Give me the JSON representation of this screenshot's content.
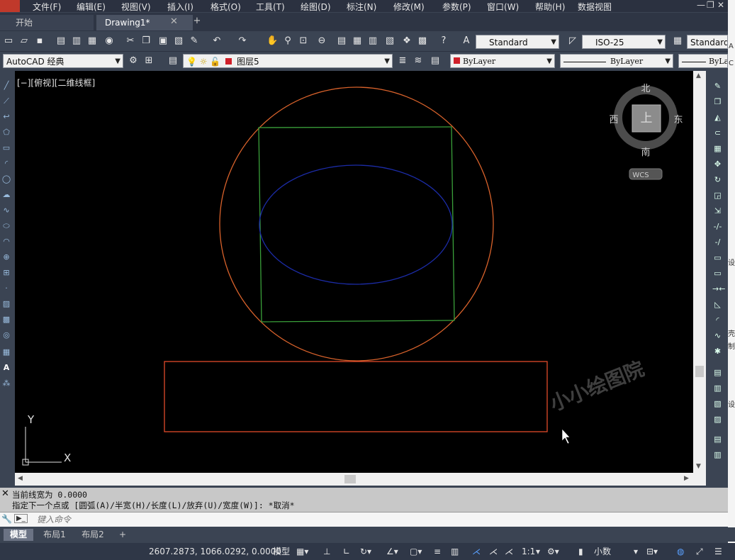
{
  "menu": [
    "文件(F)",
    "编辑(E)",
    "视图(V)",
    "插入(I)",
    "格式(O)",
    "工具(T)",
    "绘图(D)",
    "标注(N)",
    "修改(M)",
    "参数(P)",
    "窗口(W)",
    "帮助(H)",
    "数据视图"
  ],
  "window_controls": {
    "minimize": "—",
    "restore": "❐",
    "close": "✕"
  },
  "tabs": {
    "start": "开始",
    "drawing": "Drawing1*",
    "close": "✕",
    "new": "+"
  },
  "toolbar1": {
    "text_style": "Standard",
    "dim_style": "ISO-25",
    "table_style": "Standard"
  },
  "toolbar2": {
    "workspace": "AutoCAD 经典",
    "layer": "图层5",
    "color": "ByLayer",
    "linetype": "ByLayer",
    "lineweight": "ByLay"
  },
  "viewport": {
    "label": "[−][俯视][二维线框]",
    "watermark": "小小绘图院",
    "ucs_x": "X",
    "ucs_y": "Y"
  },
  "viewcube": {
    "north": "北",
    "south": "南",
    "east": "东",
    "west": "西",
    "top": "上",
    "wcs": "WCS"
  },
  "colors": {
    "circle": "#d9622b",
    "square": "#3aa03a",
    "ellipse": "#1c2ca8",
    "rectangle": "#e04a2a",
    "viewport_bg": "#000000",
    "ui_bg": "#3b4453"
  },
  "edge_text": [
    "A",
    "设",
    "壳",
    "制",
    "设",
    "C"
  ],
  "command": {
    "line1": "当前线宽为 0.0000",
    "line2": "指定下一个点或 [圆弧(A)/半宽(H)/长度(L)/放弃(U)/宽度(W)]: *取消*",
    "placeholder": "键入命令",
    "prompt_icon": "▶_"
  },
  "layout_tabs": [
    "模型",
    "布局1",
    "布局2",
    "+"
  ],
  "status": {
    "coords": "2607.2873, 1066.0292, 0.0000",
    "model": "模型",
    "scale": "1:1",
    "units": "小数"
  }
}
